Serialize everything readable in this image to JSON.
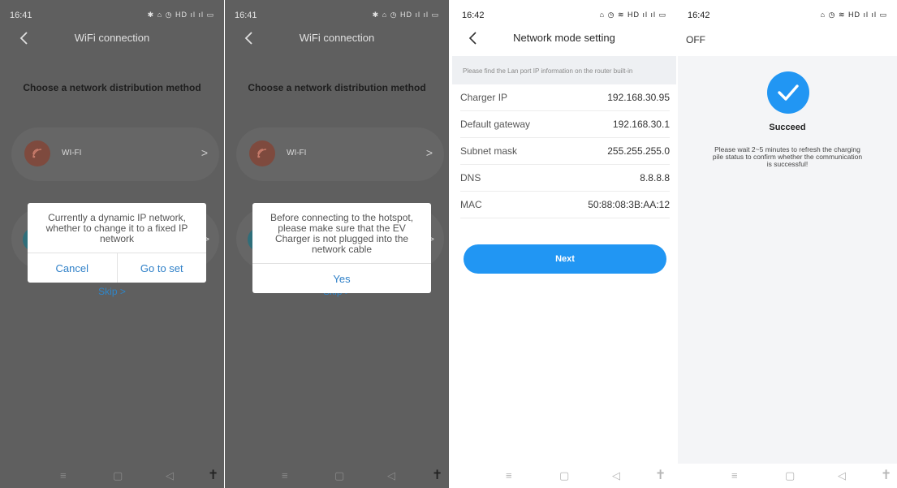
{
  "screen1": {
    "status": {
      "time": "16:41",
      "icons": "✱ ⌂ ◷ HD ıl ıl ▭"
    },
    "title": "WiFi connection",
    "heading": "Choose a network distribution method",
    "wifi_label": "WI-FI",
    "dialog_message": "Currently a dynamic IP network, whether to change it to a fixed IP network",
    "cancel_label": "Cancel",
    "go_label": "Go to set",
    "skip_label": "Skip >"
  },
  "screen2": {
    "status": {
      "time": "16:41",
      "icons": "✱ ⌂ ◷ HD ıl ıl ▭"
    },
    "title": "WiFi connection",
    "heading": "Choose a network distribution method",
    "wifi_label": "WI-FI",
    "dialog_message": "Before connecting to the hotspot, please make sure that the EV Charger is not plugged into the network cable",
    "yes_label": "Yes",
    "skip_label": "Skip >"
  },
  "screen3": {
    "status": {
      "time": "16:42",
      "icons": "⌂ ◷ ≋ HD ıl ıl ▭"
    },
    "title": "Network mode setting",
    "info": "Please find the Lan port IP information on the router built-in",
    "rows": [
      {
        "label": "Charger IP",
        "value": "192.168.30.95"
      },
      {
        "label": "Default gateway",
        "value": "192.168.30.1"
      },
      {
        "label": "Subnet mask",
        "value": "255.255.255.0"
      },
      {
        "label": "DNS",
        "value": "8.8.8.8"
      },
      {
        "label": "MAC",
        "value": "50:88:08:3B:AA:12"
      }
    ],
    "next_label": "Next"
  },
  "screen4": {
    "status": {
      "time": "16:42",
      "icons": "⌂ ◷ ≋ HD ıl ıl ▭"
    },
    "off_label": "OFF",
    "succeed_title": "Succeed",
    "succeed_message": "Please wait 2~5 minutes to refresh the charging pile status to confirm whether the communication is successful!"
  },
  "sys_nav": {
    "menu": "≡",
    "home": "▢",
    "back": "◁",
    "access": "✝"
  },
  "colors": {
    "accent": "#2196f3",
    "link": "#2f80c8",
    "overlay": "#5f5f5f"
  }
}
